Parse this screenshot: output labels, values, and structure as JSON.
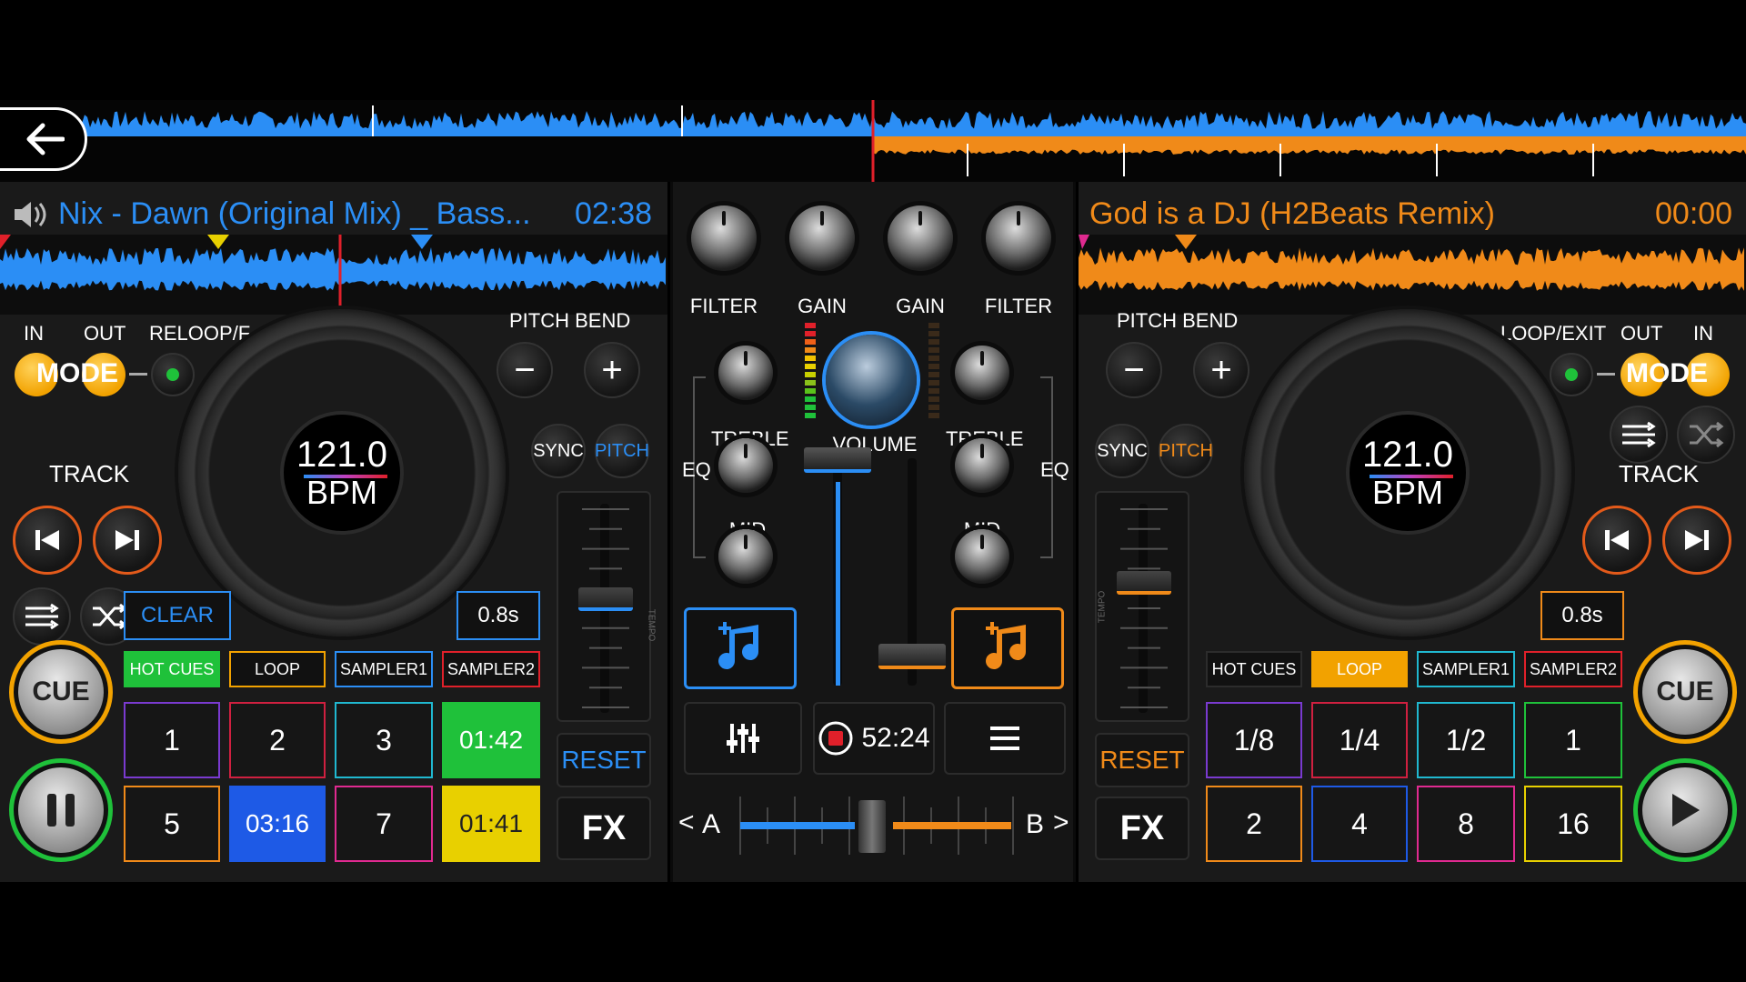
{
  "colors": {
    "deck_a": "#2b8ef5",
    "deck_b": "#f08a19",
    "green": "#1fc13a",
    "yellow": "#f2a200"
  },
  "overview": {
    "back_icon": "arrow-left-icon"
  },
  "deck_a": {
    "track_title": "Nix - Dawn (Original Mix) _ Bass...",
    "time": "02:38",
    "speaker_icon": "speaker-icon",
    "loop_labels": {
      "in": "IN",
      "out": "OUT",
      "reloop": "RELOOP/F"
    },
    "mode_label": "MODE",
    "track_label": "TRACK",
    "bpm": "121.0",
    "bpm_label": "BPM",
    "pitch_bend": "PITCH BEND",
    "minus": "−",
    "plus": "+",
    "sync": "SYNC",
    "pitch": "PITCH",
    "tempo_label": "TEMPO",
    "clear": "CLEAR",
    "delay": "0.8s",
    "reset": "RESET",
    "fx": "FX",
    "cue": "CUE",
    "tabs": [
      "HOT CUES",
      "LOOP",
      "SAMPLER1",
      "SAMPLER2"
    ],
    "pads": [
      "1",
      "2",
      "3",
      "01:42",
      "5",
      "03:16",
      "7",
      "01:41"
    ]
  },
  "deck_b": {
    "track_title": "God is a DJ (H2Beats Remix)",
    "time": "00:00",
    "loop_labels": {
      "reloop": "LOOP/EXIT",
      "out": "OUT",
      "in": "IN"
    },
    "mode_label": "MODE",
    "track_label": "TRACK",
    "bpm": "121.0",
    "bpm_label": "BPM",
    "pitch_bend": "PITCH BEND",
    "minus": "−",
    "plus": "+",
    "sync": "SYNC",
    "pitch": "PITCH",
    "tempo_label": "TEMPO",
    "delay": "0.8s",
    "reset": "RESET",
    "fx": "FX",
    "cue": "CUE",
    "tabs": [
      "HOT CUES",
      "LOOP",
      "SAMPLER1",
      "SAMPLER2"
    ],
    "pads": [
      "1/8",
      "1/4",
      "1/2",
      "1",
      "2",
      "4",
      "8",
      "16"
    ]
  },
  "mixer": {
    "filter": "FILTER",
    "gain": "GAIN",
    "treble": "TREBLE",
    "volume": "VOLUME",
    "eq": "EQ",
    "mid": "MID",
    "record_time": "52:24",
    "crossfader_a": "A",
    "crossfader_b": "B",
    "nav_left": "<",
    "nav_right": ">"
  }
}
